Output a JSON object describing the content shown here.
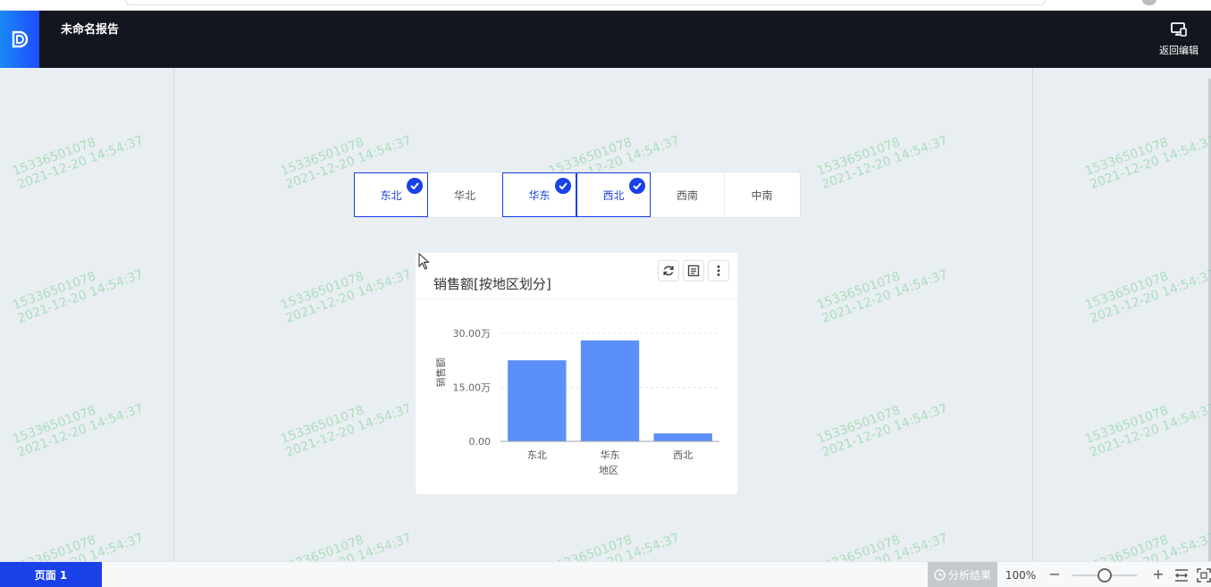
{
  "header": {
    "report_title": "未命名报告",
    "back_edit_label": "返回编辑"
  },
  "watermark": {
    "line1": "15336501078",
    "line2": "2021-12-20 14:54:37"
  },
  "filter": {
    "chips": [
      {
        "label": "东北",
        "selected": true
      },
      {
        "label": "华北",
        "selected": false
      },
      {
        "label": "华东",
        "selected": true
      },
      {
        "label": "西北",
        "selected": true
      },
      {
        "label": "西南",
        "selected": false
      },
      {
        "label": "中南",
        "selected": false
      }
    ]
  },
  "chart_card": {
    "title": "销售额[按地区划分]",
    "tools": [
      "refresh-icon",
      "detail-icon",
      "more-icon"
    ]
  },
  "chart_data": {
    "type": "bar",
    "categories": [
      "东北",
      "华东",
      "西北"
    ],
    "values": [
      225000,
      280000,
      22000
    ],
    "xlabel": "地区",
    "ylabel": "销售额",
    "ylim": [
      0,
      300000
    ],
    "yticks": [
      "0.00",
      "15.00万",
      "30.00万"
    ],
    "color": "#5b8ff9",
    "grid": true
  },
  "bottom_bar": {
    "page_tab": "页面 1",
    "analysis_label": "分析结果",
    "zoom": "100%",
    "zoom_level": 0.5
  },
  "colors": {
    "accent": "#1a40e8",
    "header_bg": "#13161e",
    "bar": "#5b8ff9"
  }
}
